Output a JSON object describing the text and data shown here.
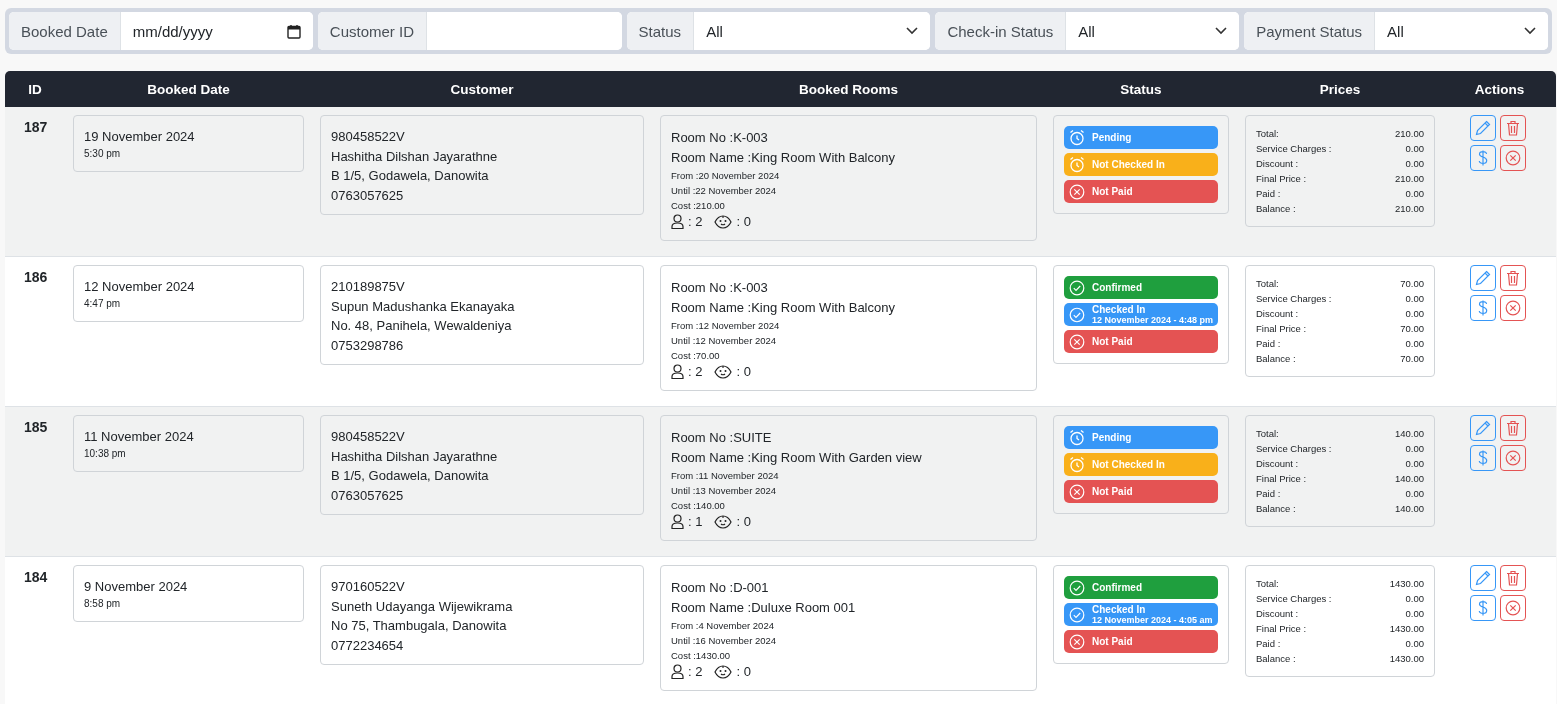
{
  "filters": [
    {
      "kind": "date",
      "label": "Booked Date",
      "placeholder": "mm/dd/yyyy"
    },
    {
      "kind": "text",
      "label": "Customer ID"
    },
    {
      "kind": "select",
      "label": "Status",
      "value": "All"
    },
    {
      "kind": "select",
      "label": "Check-in Status",
      "value": "All"
    },
    {
      "kind": "select",
      "label": "Payment Status",
      "value": "All"
    }
  ],
  "table": {
    "columns": [
      "ID",
      "Booked Date",
      "Customer",
      "Booked Rooms",
      "Status",
      "Prices",
      "Actions"
    ],
    "rows": [
      {
        "id": "187",
        "booked_date": "19 November 2024",
        "booked_time": "5:30 pm",
        "customer": [
          "980458522V",
          "Hashitha Dilshan Jayarathne",
          "B 1/5, Godawela, Danowita",
          "0763057625"
        ],
        "room": {
          "room_no": "Room No :K-003",
          "room_name": "Room Name :King Room With Balcony",
          "from": "From :20 November 2024",
          "until": "Until :22 November 2024",
          "cost": "Cost :210.00",
          "adults": ": 2",
          "children": ": 0"
        },
        "statuses": [
          {
            "kind": "pending",
            "label": "Pending"
          },
          {
            "kind": "not_checked_in",
            "label": "Not Checked In"
          },
          {
            "kind": "not_paid",
            "label": "Not Paid"
          }
        ],
        "prices": [
          {
            "label": "Total:",
            "value": "210.00"
          },
          {
            "label": "Service Charges :",
            "value": "0.00"
          },
          {
            "label": "Discount :",
            "value": "0.00"
          },
          {
            "label": "Final Price :",
            "value": "210.00"
          },
          {
            "label": "Paid :",
            "value": "0.00"
          },
          {
            "label": "Balance :",
            "value": "210.00"
          }
        ]
      },
      {
        "id": "186",
        "booked_date": "12 November 2024",
        "booked_time": "4:47 pm",
        "customer": [
          "210189875V",
          "Supun Madushanka Ekanayaka",
          "No. 48, Panihela, Wewaldeniya",
          "0753298786"
        ],
        "room": {
          "room_no": "Room No :K-003",
          "room_name": "Room Name :King Room With Balcony",
          "from": "From :12 November 2024",
          "until": "Until :12 November 2024",
          "cost": "Cost :70.00",
          "adults": ": 2",
          "children": ": 0"
        },
        "statuses": [
          {
            "kind": "confirmed",
            "label": "Confirmed"
          },
          {
            "kind": "checked_in",
            "label": "Checked In",
            "detail": "12 November 2024 - 4:48 pm"
          },
          {
            "kind": "not_paid",
            "label": "Not Paid"
          }
        ],
        "prices": [
          {
            "label": "Total:",
            "value": "70.00"
          },
          {
            "label": "Service Charges :",
            "value": "0.00"
          },
          {
            "label": "Discount :",
            "value": "0.00"
          },
          {
            "label": "Final Price :",
            "value": "70.00"
          },
          {
            "label": "Paid :",
            "value": "0.00"
          },
          {
            "label": "Balance :",
            "value": "70.00"
          }
        ]
      },
      {
        "id": "185",
        "booked_date": "11 November 2024",
        "booked_time": "10:38 pm",
        "customer": [
          "980458522V",
          "Hashitha Dilshan Jayarathne",
          "B 1/5, Godawela, Danowita",
          "0763057625"
        ],
        "room": {
          "room_no": "Room No :SUITE",
          "room_name": "Room Name :King Room With Garden view",
          "from": "From :11 November 2024",
          "until": "Until :13 November 2024",
          "cost": "Cost :140.00",
          "adults": ": 1",
          "children": ": 0"
        },
        "statuses": [
          {
            "kind": "pending",
            "label": "Pending"
          },
          {
            "kind": "not_checked_in",
            "label": "Not Checked In"
          },
          {
            "kind": "not_paid",
            "label": "Not Paid"
          }
        ],
        "prices": [
          {
            "label": "Total:",
            "value": "140.00"
          },
          {
            "label": "Service Charges :",
            "value": "0.00"
          },
          {
            "label": "Discount :",
            "value": "0.00"
          },
          {
            "label": "Final Price :",
            "value": "140.00"
          },
          {
            "label": "Paid :",
            "value": "0.00"
          },
          {
            "label": "Balance :",
            "value": "140.00"
          }
        ]
      },
      {
        "id": "184",
        "booked_date": "9 November 2024",
        "booked_time": "8:58 pm",
        "customer": [
          "970160522V",
          "Suneth Udayanga Wijewikrama",
          "No 75, Thambugala, Danowita",
          "0772234654"
        ],
        "room": {
          "room_no": "Room No :D-001",
          "room_name": "Room Name :Duluxe Room 001",
          "from": "From :4 November 2024",
          "until": "Until :16 November 2024",
          "cost": "Cost :1430.00",
          "adults": ": 2",
          "children": ": 0"
        },
        "statuses": [
          {
            "kind": "confirmed",
            "label": "Confirmed"
          },
          {
            "kind": "checked_in",
            "label": "Checked In",
            "detail": "12 November 2024 - 4:05 am"
          },
          {
            "kind": "not_paid",
            "label": "Not Paid"
          }
        ],
        "prices": [
          {
            "label": "Total:",
            "value": "1430.00"
          },
          {
            "label": "Service Charges :",
            "value": "0.00"
          },
          {
            "label": "Discount :",
            "value": "0.00"
          },
          {
            "label": "Final Price :",
            "value": "1430.00"
          },
          {
            "label": "Paid :",
            "value": "0.00"
          },
          {
            "label": "Balance :",
            "value": "1430.00"
          }
        ]
      }
    ]
  }
}
